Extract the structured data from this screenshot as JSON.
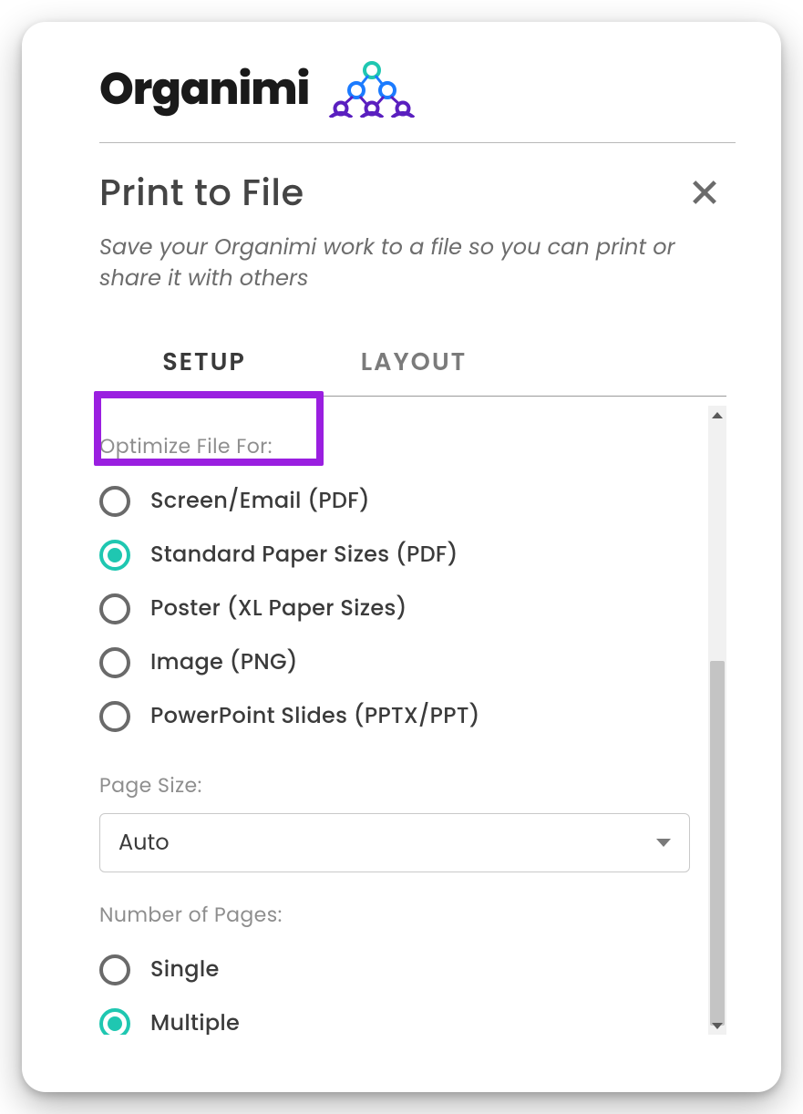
{
  "brand": {
    "name": "Organimi"
  },
  "dialog": {
    "title": "Print to File",
    "subtitle": "Save your Organimi work to a file so you can print or share it with others"
  },
  "tabs": {
    "setup": "SETUP",
    "layout": "LAYOUT",
    "active": "setup"
  },
  "optimize": {
    "label": "Optimize File For:",
    "options": [
      {
        "id": "screen",
        "label": "Screen/Email (PDF)",
        "selected": false
      },
      {
        "id": "standard",
        "label": "Standard Paper Sizes (PDF)",
        "selected": true
      },
      {
        "id": "poster",
        "label": "Poster (XL Paper Sizes)",
        "selected": false
      },
      {
        "id": "image",
        "label": "Image (PNG)",
        "selected": false
      },
      {
        "id": "pptx",
        "label": "PowerPoint Slides (PPTX/PPT)",
        "selected": false
      }
    ]
  },
  "page_size": {
    "label": "Page Size:",
    "value": "Auto"
  },
  "num_pages": {
    "label": "Number of Pages:",
    "options": [
      {
        "id": "single",
        "label": "Single",
        "selected": false
      },
      {
        "id": "multiple",
        "label": "Multiple",
        "selected": true
      }
    ]
  },
  "colors": {
    "accent": "#1fc7b1",
    "highlight": "#9a1fe0"
  }
}
